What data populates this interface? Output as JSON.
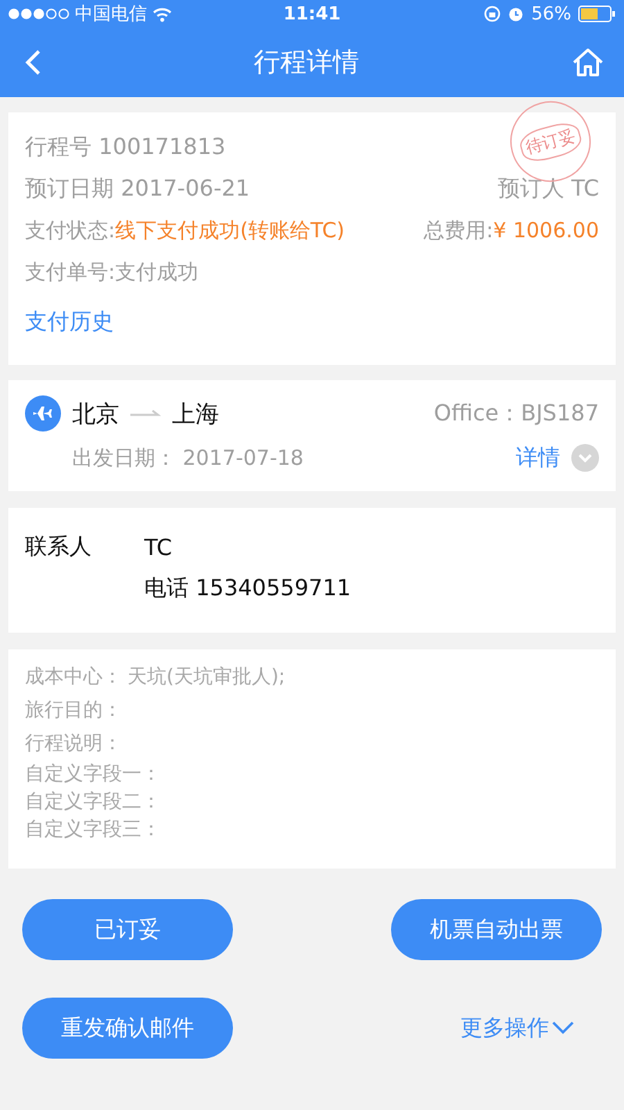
{
  "status_bar": {
    "carrier": "中国电信",
    "time": "11:41",
    "battery": "56%"
  },
  "nav": {
    "title": "行程详情"
  },
  "order": {
    "stamp": "待订妥",
    "trip_no": "行程号 100171813",
    "booking_date": "预订日期 2017-06-21",
    "booker": "预订人 TC",
    "pay_status_label": "支付状态:",
    "pay_status": "线下支付成功(转账给TC)",
    "total_label": "总费用:",
    "total": "¥ 1006.00",
    "pay_no": "支付单号:支付成功",
    "history_link": "支付历史"
  },
  "flight": {
    "from": "北京",
    "to": "上海",
    "office": "Office：BJS187",
    "depart": "出发日期：  2017-07-18",
    "details_link": "详情",
    "expanded": false
  },
  "contact": {
    "label": "联系人",
    "name": "TC",
    "phone": "电话 15340559711"
  },
  "extras": [
    {
      "label": "成本中心：",
      "value": "天坑(天坑审批人);"
    },
    {
      "label": "旅行目的："
    },
    {
      "label": "行程说明："
    },
    {
      "label": "自定义字段一：",
      "kind": "custom"
    },
    {
      "label": "自定义字段二：",
      "kind": "custom"
    },
    {
      "label": "自定义字段三：",
      "kind": "custom"
    }
  ],
  "actions": [
    {
      "label": "已订妥",
      "kind": "button"
    },
    {
      "label": "机票自动出票",
      "kind": "button"
    },
    {
      "label": "重发确认邮件",
      "kind": "button"
    },
    {
      "label": "更多操作",
      "kind": "link"
    }
  ]
}
